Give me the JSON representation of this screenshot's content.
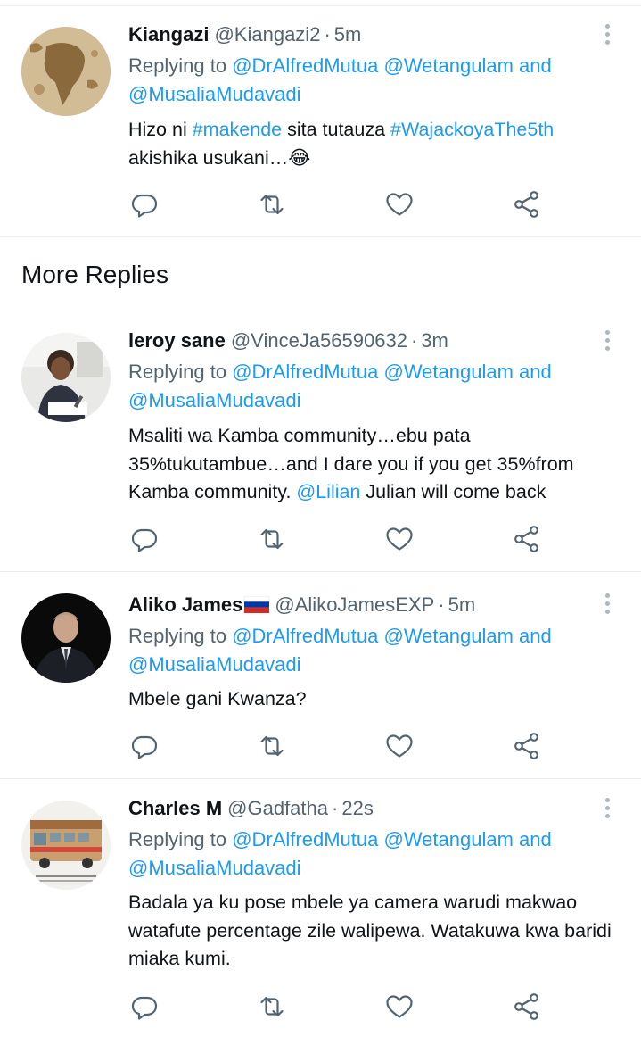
{
  "section": {
    "more_replies": "More Replies"
  },
  "replying": {
    "prefix": "Replying to ",
    "mention1": "@DrAlfredMutua",
    "mention2": "@Wetangulam",
    "and": " and",
    "mention3": "@MusaliaMudavadi"
  },
  "tweets": [
    {
      "name": "Kiangazi",
      "handle": "@Kiangazi2",
      "sep": "·",
      "time": "5m",
      "text_parts": {
        "t1": "Hizo ni ",
        "tag1": "#makende",
        "t2": " sita tutauza ",
        "tag2": "#WajackoyaThe5th",
        "t3": " akishika usukani…",
        "emoji": "😂"
      }
    },
    {
      "name": "leroy sane",
      "handle": "@VinceJa56590632",
      "sep": "·",
      "time": "3m",
      "text_parts": {
        "t1": "Msaliti wa Kamba community…ebu pata 35%tukutambue…and I dare you if you get 35%from Kamba community. ",
        "mention": "@Lilian",
        "t2": " Julian will come back"
      }
    },
    {
      "name": "Aliko James",
      "handle": "@AlikoJamesEXP",
      "sep": "·",
      "time": "5m",
      "text": "Mbele gani Kwanza?"
    },
    {
      "name": "Charles M",
      "handle": "@Gadfatha",
      "sep": "·",
      "time": "22s",
      "text": "Badala ya ku pose mbele ya camera warudi makwao watafute percentage zile walipewa. Watakuwa kwa baridi miaka kumi."
    }
  ],
  "icons": {
    "reply": "reply-icon",
    "retweet": "retweet-icon",
    "like": "like-icon",
    "share": "share-icon",
    "more": "more-options-icon",
    "flag": "russia-flag-icon"
  },
  "colors": {
    "link": "#1d9bf0",
    "muted": "#536471",
    "icon": "#536471",
    "divider": "#e6ecf0"
  }
}
